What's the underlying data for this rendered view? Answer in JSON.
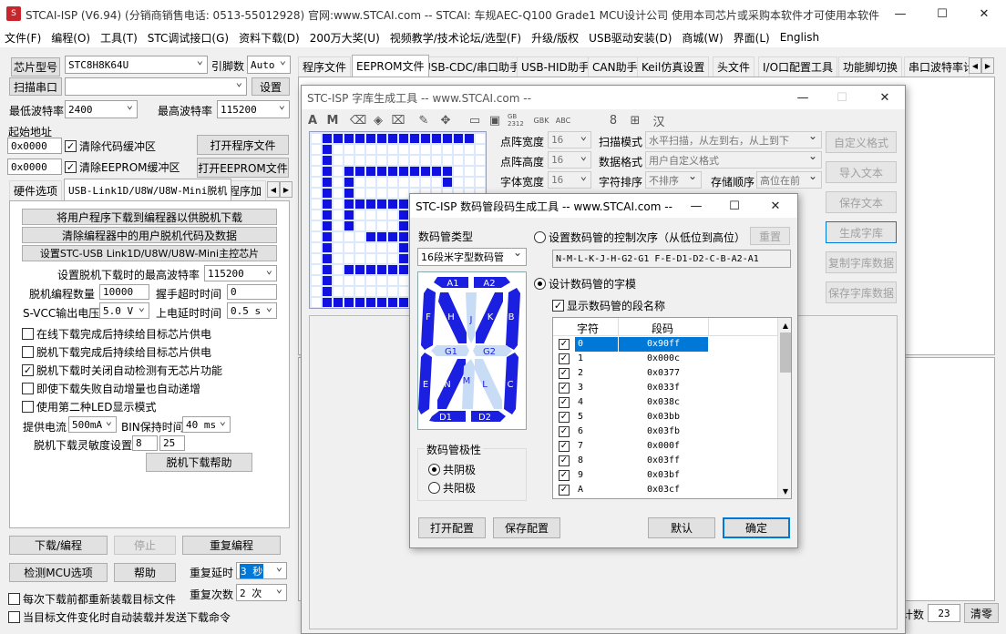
{
  "main_window": {
    "title": "STCAI-ISP (V6.94) (分销商销售电话: 0513-55012928) 官网:www.STCAI.com  -- STCAI: 车规AEC-Q100 Grade1 MCU设计公司 使用本司芯片或采购本软件才可使用本软件"
  },
  "menu": [
    "文件(F)",
    "编程(O)",
    "工具(T)",
    "STC调试接口(G)",
    "资料下载(D)",
    "200万大奖(U)",
    "视频教学/技术论坛/选型(F)",
    "升级/版权",
    "USB驱动安装(D)",
    "商城(W)",
    "界面(L)",
    "English"
  ],
  "left": {
    "chip_label": "芯片型号",
    "chip_value": "STC8H8K64U",
    "pin_label": "引脚数",
    "pin_value": "Auto",
    "scan_button": "扫描串口",
    "port_value": "",
    "settings_button": "设置",
    "min_baud_label": "最低波特率",
    "min_baud_value": "2400",
    "max_baud_label": "最高波特率",
    "max_baud_value": "115200",
    "start_addr_label": "起始地址",
    "addr1": "0x0000",
    "clear_code": "清除代码缓冲区",
    "open_prog": "打开程序文件",
    "addr2": "0x0000",
    "clear_eeprom": "清除EEPROM缓冲区",
    "open_eeprom": "打开EEPROM文件",
    "tabs": [
      "硬件选项",
      "USB-Link1D/U8W/U8W-Mini脱机",
      "程序加"
    ],
    "link_buttons": [
      "将用户程序下载到编程器以供脱机下载",
      "清除编程器中的用户脱机代码及数据",
      "设置STC-USB Link1D/U8W/U8W-Mini主控芯片"
    ],
    "offline_baud_label": "设置脱机下载时的最高波特率",
    "offline_baud_value": "115200",
    "prog_count_label": "脱机编程数量",
    "prog_count_value": "10000",
    "handshake_label": "握手超时时间",
    "handshake_value": "0",
    "vcc_label": "S-VCC输出电压",
    "vcc_value": "5.0 V",
    "power_delay_label": "上电延时时间",
    "power_delay_value": "0.5 s",
    "options": [
      {
        "label": "在线下载完成后持续给目标芯片供电",
        "checked": false
      },
      {
        "label": "脱机下载完成后持续给目标芯片供电",
        "checked": false
      },
      {
        "label": "脱机下载时关闭自动检测有无芯片功能",
        "checked": true
      },
      {
        "label": "即使下载失败自动增量也自动递增",
        "checked": false
      },
      {
        "label": "使用第二种LED显示模式",
        "checked": false
      }
    ],
    "current_label": "提供电流",
    "current_value": "500mA",
    "bin_label": "BIN保持时间",
    "bin_value": "40 ms",
    "sens_label": "脱机下载灵敏度设置",
    "sens1": "8",
    "sens2": "25",
    "offline_help": "脱机下载帮助",
    "download_btn": "下载/编程",
    "stop_btn": "停止",
    "reprog_btn": "重复编程",
    "detect_btn": "检测MCU选项",
    "help_btn": "帮助",
    "repeat_delay_label": "重复延时",
    "repeat_delay_value": "3 秒",
    "repeat_count_label": "重复次数",
    "repeat_count_value": "2 次",
    "reload_each": "每次下载前都重新装载目标文件",
    "auto_reload": "当目标文件变化时自动装载并发送下载命令"
  },
  "right_tabs": [
    "程序文件",
    "EEPROM文件",
    "USB-CDC/串口助手",
    "USB-HID助手",
    "CAN助手",
    "Keil仿真设置",
    "头文件",
    "I/O口配置工具",
    "功能脚切换",
    "串口波特率计"
  ],
  "count": {
    "label": "计数",
    "value": "23",
    "clear": "清零"
  },
  "font_tool": {
    "title": "STC-ISP 字库生成工具 -- www.STCAI.com --",
    "toolbar_icons": [
      "bold-a-icon",
      "bold-m-icon",
      "eraser-icon",
      "fill-icon",
      "clear-icon",
      "pen-icon",
      "move-icon",
      "folder-icon",
      "save-icon",
      "gb2312-icon",
      "gbk-icon",
      "abc-icon",
      "digit-icon",
      "grid-icon",
      "han-icon"
    ],
    "toolbar_text": {
      "gb": "GB 2312",
      "gbk": "GBK",
      "abc": "ABC",
      "eight": "8",
      "han": "汉"
    },
    "width_label": "点阵宽度",
    "width_value": "16",
    "height_label": "点阵高度",
    "height_value": "16",
    "fontw_label": "字体宽度",
    "fontw_value": "16",
    "scan_label": "扫描模式",
    "scan_value": "水平扫描，从左到右，从上到下",
    "data_label": "数据格式",
    "data_value": "用户自定义格式",
    "sort_label": "字符排序",
    "sort_value": "不排序",
    "order_label": "存储顺序",
    "order_value": "高位在前",
    "buttons": [
      "自定义格式",
      "导入文本",
      "保存文本",
      "生成字库",
      "复制字库数据",
      "保存字库数据"
    ]
  },
  "seg_tool": {
    "title": "STC-ISP 数码管段码生成工具 -- www.STCAI.com --",
    "type_label": "数码管类型",
    "type_value": "16段米字型数码管",
    "order_radio": "设置数码管的控制次序（从低位到高位）",
    "reset_btn": "重置",
    "order_value": "N-M-L-K-J-H-G2-G1  F-E-D1-D2-C-B-A2-A1",
    "shape_radio": "设计数码管的字模",
    "show_names": "显示数码管的段名称",
    "col_char": "字符",
    "col_code": "段码",
    "rows": [
      {
        "char": "0",
        "code": "0x90ff"
      },
      {
        "char": "1",
        "code": "0x000c"
      },
      {
        "char": "2",
        "code": "0x0377"
      },
      {
        "char": "3",
        "code": "0x033f"
      },
      {
        "char": "4",
        "code": "0x038c"
      },
      {
        "char": "5",
        "code": "0x03bb"
      },
      {
        "char": "6",
        "code": "0x03fb"
      },
      {
        "char": "7",
        "code": "0x000f"
      },
      {
        "char": "8",
        "code": "0x03ff"
      },
      {
        "char": "9",
        "code": "0x03bf"
      },
      {
        "char": "A",
        "code": "0x03cf"
      }
    ],
    "segments": [
      "A1",
      "A2",
      "F",
      "H",
      "J",
      "K",
      "B",
      "G1",
      "G2",
      "E",
      "N",
      "M",
      "L",
      "C",
      "D1",
      "D2"
    ],
    "polarity_label": "数码管极性",
    "cathode": "共阴极",
    "anode": "共阳极",
    "open_cfg": "打开配置",
    "save_cfg": "保存配置",
    "default_btn": "默认",
    "ok_btn": "确定"
  },
  "colors": {
    "seg_on": "#1a1fe0",
    "seg_off": "#c9dcf6",
    "select": "#0078d7",
    "grid_on": "#1010e0"
  }
}
